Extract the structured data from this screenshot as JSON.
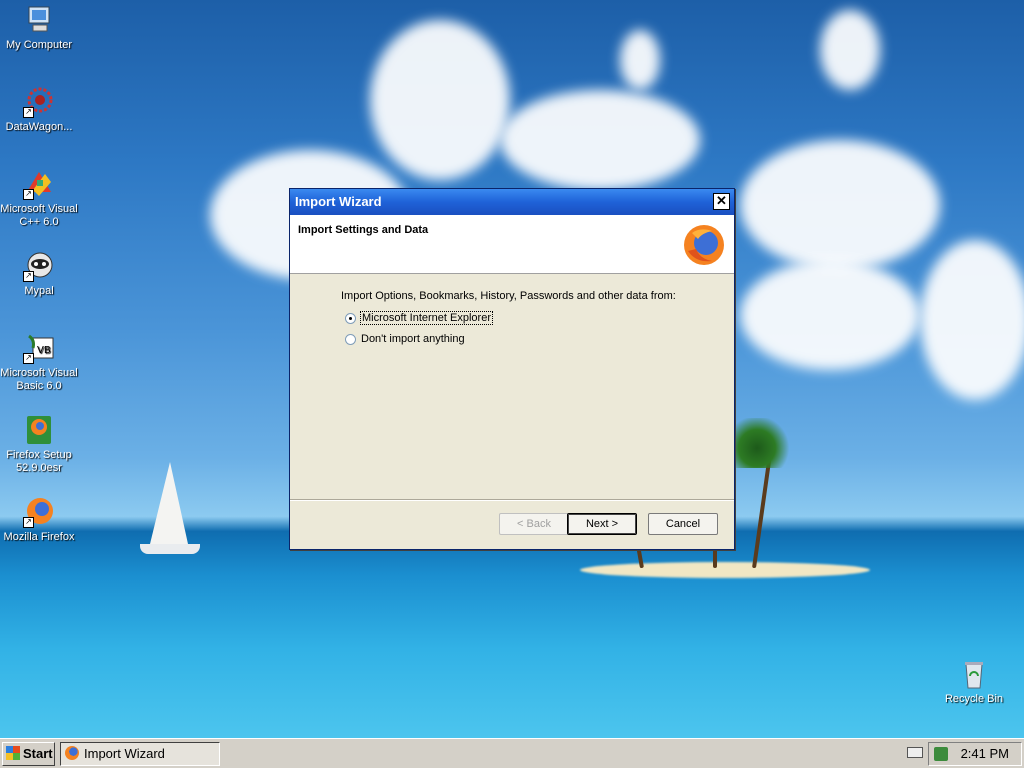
{
  "desktop": {
    "icons": [
      {
        "label": "My Computer",
        "icon": "my-computer-icon"
      },
      {
        "label": "DataWagon...",
        "icon": "datawagon-icon"
      },
      {
        "label": "Microsoft Visual C++ 6.0",
        "icon": "visual-cpp-icon"
      },
      {
        "label": "Mypal",
        "icon": "mypal-icon"
      },
      {
        "label": "Microsoft Visual Basic 6.0",
        "icon": "visual-basic-icon"
      },
      {
        "label": "Firefox Setup 52.9.0esr",
        "icon": "firefox-setup-icon"
      },
      {
        "label": "Mozilla Firefox",
        "icon": "firefox-icon"
      },
      {
        "label": "Recycle Bin",
        "icon": "recycle-bin-icon"
      }
    ]
  },
  "dialog": {
    "title": "Import Wizard",
    "close_glyph": "✕",
    "header_title": "Import Settings and Data",
    "prompt": "Import Options, Bookmarks, History, Passwords and other data from:",
    "options": [
      {
        "label": "Microsoft Internet Explorer",
        "checked": true
      },
      {
        "label": "Don't import anything",
        "checked": false
      }
    ],
    "buttons": {
      "back": "< Back",
      "next": "Next >",
      "cancel": "Cancel"
    }
  },
  "taskbar": {
    "start_label": "Start",
    "task_label": "Import Wizard",
    "clock": "2:41 PM"
  },
  "colors": {
    "titlebar": "#1f62d8",
    "dialog_bg": "#ece9d8",
    "taskbar_bg": "#d4d0c8"
  }
}
